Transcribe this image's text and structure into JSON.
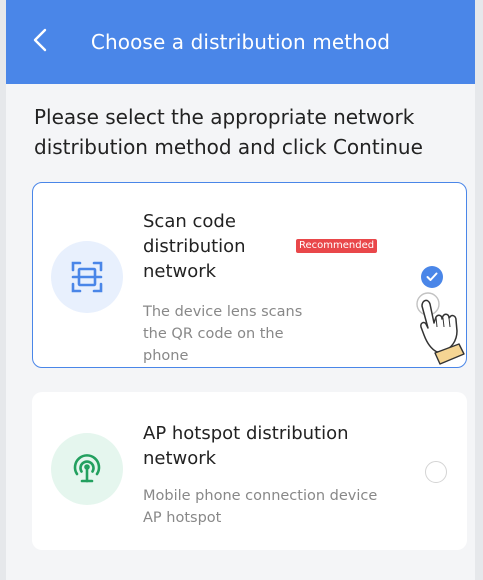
{
  "header": {
    "back_icon": "chevron-left-icon",
    "title": "Choose a distribution method"
  },
  "instruction": "Please select the appropriate network distribution method and click Continue",
  "options": [
    {
      "title": "Scan code distribution network",
      "badge": "Recommended",
      "description": "The device lens scans the QR code on the phone",
      "icon": "qr-scan-icon",
      "selected": true,
      "color": "#4a86e8"
    },
    {
      "title": "AP hotspot distribution network",
      "description": "Mobile phone connection device AP hotspot",
      "icon": "wifi-hotspot-icon",
      "selected": false,
      "color": "#23a05f"
    }
  ],
  "colors": {
    "accent": "#4a86e8",
    "badge": "#e9474a",
    "hotspot": "#23a05f"
  }
}
